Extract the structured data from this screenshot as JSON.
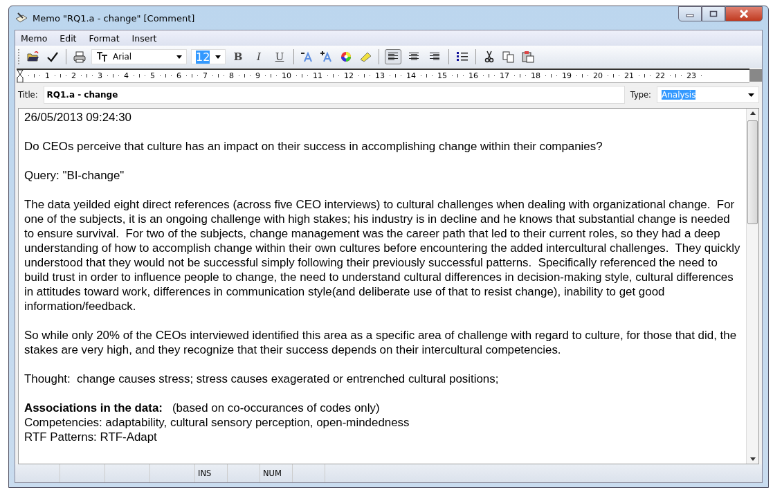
{
  "window": {
    "title": "Memo \"RQ1.a - change\" [Comment]"
  },
  "menu": [
    {
      "label": "Memo"
    },
    {
      "label": "Edit"
    },
    {
      "label": "Format"
    },
    {
      "label": "Insert"
    }
  ],
  "toolbar": [
    {
      "kind": "open"
    },
    {
      "kind": "check"
    },
    {
      "kind": "sep"
    },
    {
      "kind": "print"
    },
    {
      "kind": "font",
      "value": "Arial"
    },
    {
      "kind": "size",
      "value": "12"
    },
    {
      "kind": "bold",
      "label": "B",
      "selected": false
    },
    {
      "kind": "italic",
      "label": "I",
      "selected": false
    },
    {
      "kind": "underline",
      "label": "U",
      "selected": false
    },
    {
      "kind": "sep"
    },
    {
      "kind": "shrink"
    },
    {
      "kind": "grow"
    },
    {
      "kind": "color"
    },
    {
      "kind": "highlight"
    },
    {
      "kind": "sep"
    },
    {
      "kind": "align-left",
      "selected": true
    },
    {
      "kind": "align-center",
      "selected": false
    },
    {
      "kind": "align-right",
      "selected": false
    },
    {
      "kind": "sep"
    },
    {
      "kind": "bullets"
    },
    {
      "kind": "sep"
    },
    {
      "kind": "cut"
    },
    {
      "kind": "copy"
    },
    {
      "kind": "paste"
    }
  ],
  "ruler": [
    "1",
    "2",
    "3",
    "4",
    "5",
    "6",
    "7",
    "8",
    "9",
    "10",
    "11",
    "12",
    "13",
    "14",
    "15",
    "16",
    "17",
    "18",
    "19",
    "20",
    "21",
    "22",
    "23"
  ],
  "title_field": {
    "label": "Title:",
    "value": "RQ1.a - change"
  },
  "type_field": {
    "label": "Type:",
    "value": "Analysis"
  },
  "paragraphs": [
    {
      "kind": "para",
      "text": "26/05/2013 09:24:30"
    },
    {
      "kind": "para",
      "text": "Do CEOs perceive that culture has an impact on their success in accomplishing change within their companies?"
    },
    {
      "kind": "para",
      "text": "Query: \"BI-change\""
    },
    {
      "kind": "para",
      "text": "The data yeilded eight direct references (across five CEO interviews) to cultural challenges when dealing with organizational change.  For one of the subjects, it is an ongoing challenge with high stakes; his industry is in decline and he knows that substantial change is needed to ensure survival.  For two of the subjects, change management was the career path that led to their current roles, so they had a deep understanding of how to accomplish change within their own cultures before encountering the added intercultural challenges.  They quickly understood that they would not be successful simply following their previously successful patterns.  Specifically referenced the need to build trust in order to influence people to change, the need to understand cultural differences in decision-making style, cultural differences in attitudes toward work, differences in communication style(and deliberate use of that to resist change), inability to get good information/feedback."
    },
    {
      "kind": "para",
      "text": "So while only 20% of the CEOs interviewed identified this area as a specific area of challenge with regard to culture, for those that did, the stakes are very high, and they recognize that their success depends on their intercultural competencies."
    },
    {
      "kind": "para",
      "text": "Thought:  change causes stress; stress causes exagerated or entrenched cultural positions;"
    },
    {
      "kind": "line",
      "text": "**Associations in the data:**   (based on co-occurances of codes only)"
    },
    {
      "kind": "line",
      "text": "Competencies: adaptability, cultural sensory perception, open-mindedness"
    },
    {
      "kind": "line",
      "text": "RTF Patterns: RTF-Adapt"
    }
  ],
  "status_bar": [
    {
      "label": "INS"
    },
    {
      "label": "NUM"
    }
  ]
}
